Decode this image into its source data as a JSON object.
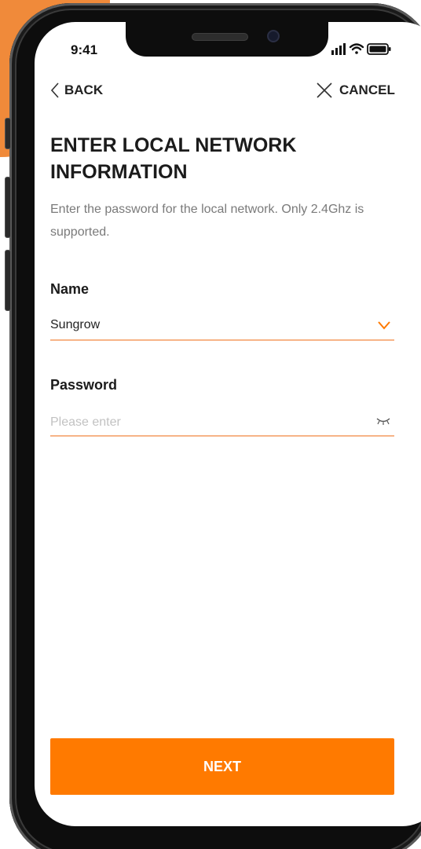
{
  "status_bar": {
    "time": "9:41",
    "icons": [
      "signal-icon",
      "wifi-icon",
      "battery-icon"
    ]
  },
  "nav": {
    "back_label": "BACK",
    "cancel_label": "CANCEL"
  },
  "page": {
    "title": "ENTER LOCAL NETWORK INFORMATION",
    "description": "Enter the password for the local network. Only 2.4Ghz is supported."
  },
  "form": {
    "name_label": "Name",
    "name_value": "Sungrow",
    "password_label": "Password",
    "password_value": "",
    "password_placeholder": "Please enter"
  },
  "actions": {
    "next_label": "NEXT"
  },
  "colors": {
    "accent": "#FF7A00",
    "field_underline": "#F7B487",
    "backdrop": "#F08A3A"
  }
}
